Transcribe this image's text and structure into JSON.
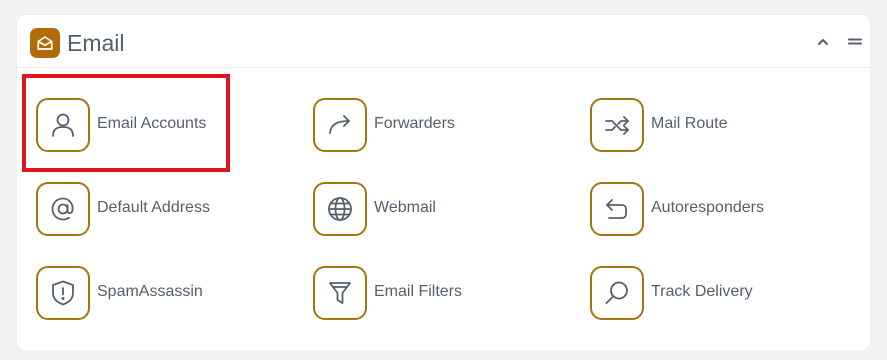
{
  "panel": {
    "title": "Email",
    "header_icon": "mail-envelope-icon",
    "accent_color": "#b26b09",
    "icon_border_color": "#a27710",
    "controls": {
      "collapse_icon": "chevron-up-icon",
      "menu_icon": "menu-lines-icon"
    }
  },
  "tiles": [
    {
      "label": "Email Accounts",
      "icon": "user-icon"
    },
    {
      "label": "Forwarders",
      "icon": "forward-arrow-icon"
    },
    {
      "label": "Mail Route",
      "icon": "route-arrows-icon"
    },
    {
      "label": "Default Address",
      "icon": "at-sign-icon"
    },
    {
      "label": "Webmail",
      "icon": "globe-icon"
    },
    {
      "label": "Autoresponders",
      "icon": "return-arrow-icon"
    },
    {
      "label": "SpamAssassin",
      "icon": "shield-alert-icon"
    },
    {
      "label": "Email Filters",
      "icon": "filter-funnel-icon"
    },
    {
      "label": "Track Delivery",
      "icon": "search-icon"
    }
  ],
  "highlight": {
    "target": "Email Accounts",
    "color": "#e0141b"
  }
}
